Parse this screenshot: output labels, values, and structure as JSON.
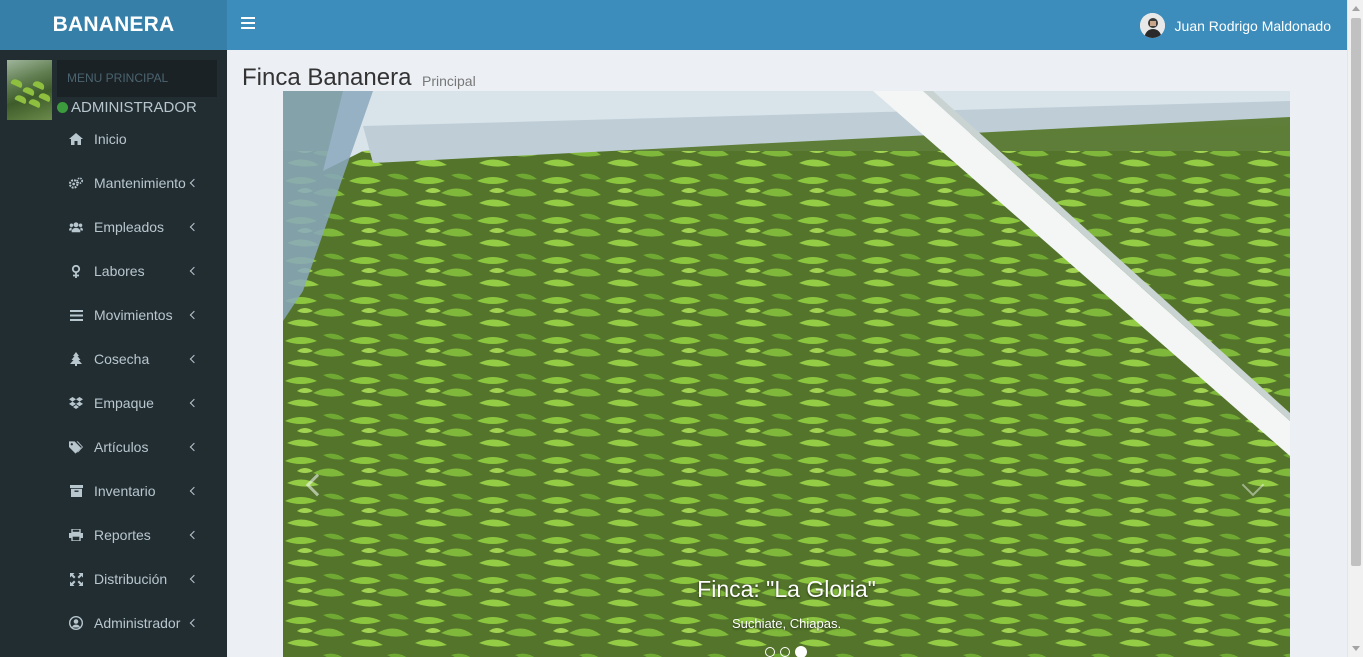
{
  "app": {
    "logo": "BANANERA"
  },
  "header": {
    "user_name": "Juan Rodrigo Maldonado"
  },
  "sidebar": {
    "menu_header": "MENU PRINCIPAL",
    "role": "ADMINISTRADOR",
    "status_color": "#3c9b3c",
    "items": [
      {
        "label": "Inicio",
        "icon": "home-icon",
        "has_submenu": false
      },
      {
        "label": "Mantenimiento",
        "icon": "cogs-icon",
        "has_submenu": true
      },
      {
        "label": "Empleados",
        "icon": "users-icon",
        "has_submenu": true
      },
      {
        "label": "Labores",
        "icon": "female-icon",
        "has_submenu": true
      },
      {
        "label": "Movimientos",
        "icon": "bars-icon",
        "has_submenu": true
      },
      {
        "label": "Cosecha",
        "icon": "tree-icon",
        "has_submenu": true
      },
      {
        "label": "Empaque",
        "icon": "dropbox-icon",
        "has_submenu": true
      },
      {
        "label": "Artículos",
        "icon": "tags-icon",
        "has_submenu": true
      },
      {
        "label": "Inventario",
        "icon": "archive-icon",
        "has_submenu": true
      },
      {
        "label": "Reportes",
        "icon": "print-icon",
        "has_submenu": true
      },
      {
        "label": "Distribución",
        "icon": "arrows-icon",
        "has_submenu": true
      },
      {
        "label": "Administrador",
        "icon": "user-circle-icon",
        "has_submenu": true
      }
    ]
  },
  "main": {
    "title": "Finca Bananera",
    "subtitle": "Principal",
    "carousel": {
      "caption_title": "Finca: \"La Gloria\"",
      "caption_sub": "Suchiate, Chiapas.",
      "slide_count": 3,
      "active_index": 2
    }
  },
  "colors": {
    "header": "#3c8dbc",
    "logo_bg": "#367fa9",
    "sidebar": "#222d32",
    "content_bg": "#ecf0f5"
  }
}
